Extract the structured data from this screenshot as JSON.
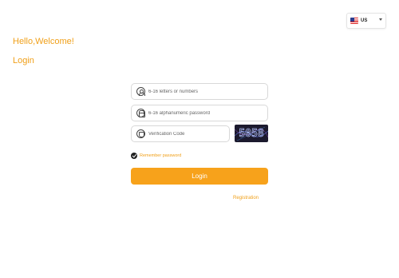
{
  "language": {
    "flag_icon": "us-flag-icon",
    "selected": "US"
  },
  "header": {
    "greeting": "Hello,Welcome!",
    "title": "Login"
  },
  "form": {
    "username": {
      "placeholder": "6-16 letters or numbers",
      "value": "",
      "icon": "user-icon"
    },
    "password": {
      "placeholder": "6-16 alphanumeric password",
      "value": "",
      "icon": "lock-icon"
    },
    "verification": {
      "placeholder": "Verification Code",
      "value": "",
      "icon": "shield-icon"
    },
    "captcha_text": "5058",
    "remember_label": "Remember password",
    "remember_checked": true,
    "submit_label": "Login",
    "register_label": "Registration"
  },
  "colors": {
    "accent": "#f7a21b",
    "accent_text": "#f0a01a",
    "captcha_bg": "#1c1a2e"
  }
}
